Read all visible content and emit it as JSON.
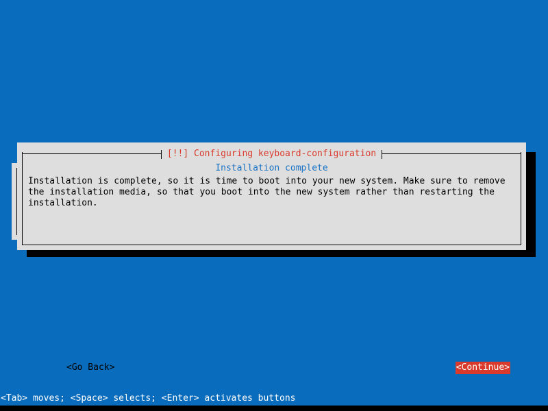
{
  "screen": {
    "background_color": "#0a6cbc",
    "bottom_bar_color": "#000000"
  },
  "dialog": {
    "title": "[!!] Configuring keyboard-configuration",
    "title_color": "#d93a2b",
    "panel_color": "#dedede",
    "heading": "Installation complete",
    "heading_color": "#1a72c4",
    "body": "Installation is complete, so it is time to boot into your new system. Make sure to remove the installation media, so that you boot into the new system rather than restarting the installation.",
    "buttons": {
      "go_back": "<Go Back>",
      "continue": "<Continue>",
      "continue_highlight_color": "#d93a2b",
      "continue_text_color": "#ffffff"
    }
  },
  "status_bar": {
    "text": "<Tab> moves; <Space> selects; <Enter> activates buttons",
    "text_color": "#ffffff",
    "background_color": "#0a6cbc"
  }
}
